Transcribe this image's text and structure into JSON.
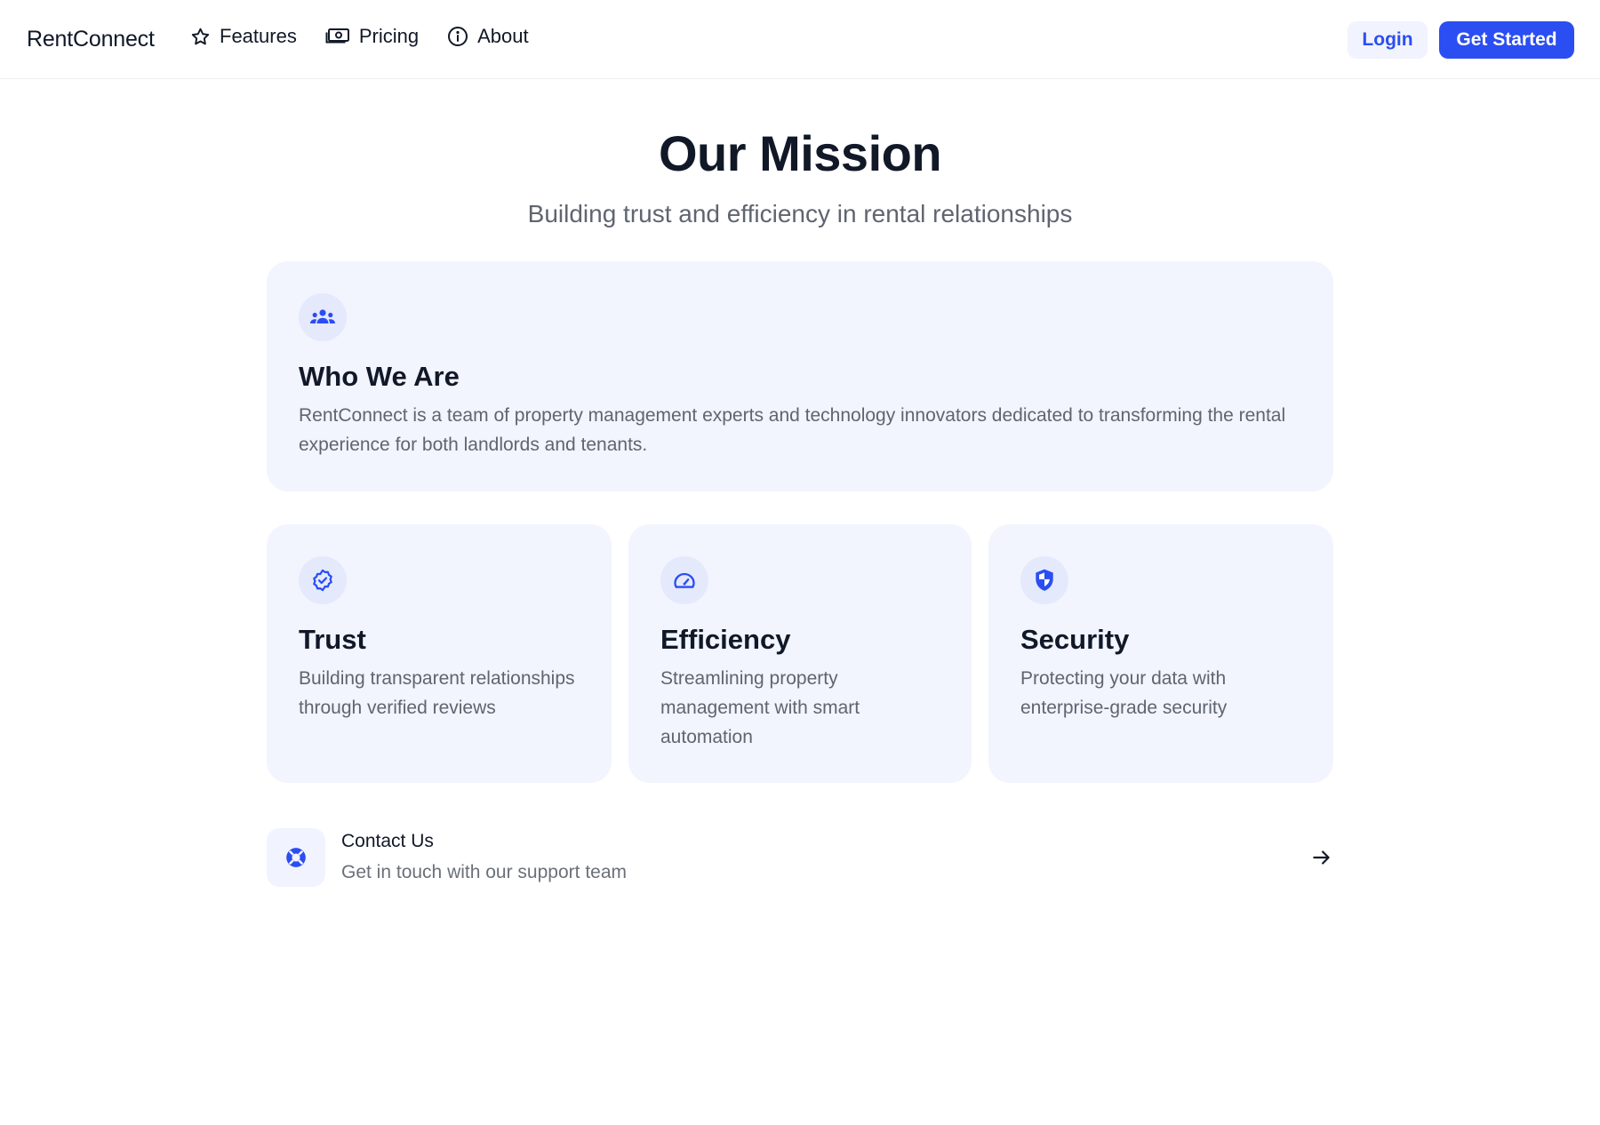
{
  "nav": {
    "brand": "RentConnect",
    "links": [
      {
        "label": "Features",
        "icon": "star-icon"
      },
      {
        "label": "Pricing",
        "icon": "banknote-icon"
      },
      {
        "label": "About",
        "icon": "info-icon"
      }
    ],
    "login_label": "Login",
    "get_started_label": "Get Started"
  },
  "hero": {
    "title": "Our Mission",
    "subtitle": "Building trust and efficiency in rental relationships"
  },
  "who_we_are": {
    "icon": "users-group-icon",
    "title": "Who We Are",
    "description": "RentConnect is a team of property management experts and technology innovators dedicated to transforming the rental experience for both landlords and tenants."
  },
  "values": [
    {
      "icon": "verified-badge-icon",
      "title": "Trust",
      "description": "Building transparent relationships through verified reviews"
    },
    {
      "icon": "speedometer-icon",
      "title": "Efficiency",
      "description": "Streamlining property management with smart automation"
    },
    {
      "icon": "shield-icon",
      "title": "Security",
      "description": "Protecting your data with enterprise-grade security"
    }
  ],
  "contact": {
    "icon": "lifebuoy-icon",
    "title": "Contact Us",
    "subtitle": "Get in touch with our support team",
    "arrow_icon": "arrow-right-icon"
  },
  "colors": {
    "accent": "#2a4ef2",
    "card_bg": "#f2f4fe",
    "icon_bg": "#e5e9fc",
    "text_primary": "#111827",
    "text_muted": "#5f6570"
  }
}
